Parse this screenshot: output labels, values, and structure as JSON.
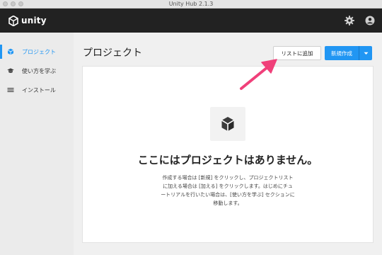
{
  "window": {
    "title": "Unity Hub 2.1.3"
  },
  "header": {
    "logo_text": "unity",
    "icons": [
      "gear-icon",
      "account-icon"
    ]
  },
  "sidebar": {
    "items": [
      {
        "label": "プロジェクト",
        "icon": "cube-icon",
        "active": true
      },
      {
        "label": "使い方を学ぶ",
        "icon": "graduation-cap-icon",
        "active": false
      },
      {
        "label": "インストール",
        "icon": "list-icon",
        "active": false
      }
    ]
  },
  "main": {
    "title": "プロジェクト",
    "add_button": "リストに追加",
    "new_button": "新規作成",
    "empty": {
      "icon": "cube-icon",
      "title": "ここにはプロジェクトはありません。",
      "description": "作成する場合は [新規] をクリックし、プロジェクトリストに加える場合は [加える] をクリックします。はじめにチュートリアルを行いたい場合は、[使い方を学ぶ] セクションに移動します。"
    }
  },
  "colors": {
    "accent": "#2196f3",
    "appbar": "#222222",
    "annotation_arrow": "#f0407a"
  }
}
